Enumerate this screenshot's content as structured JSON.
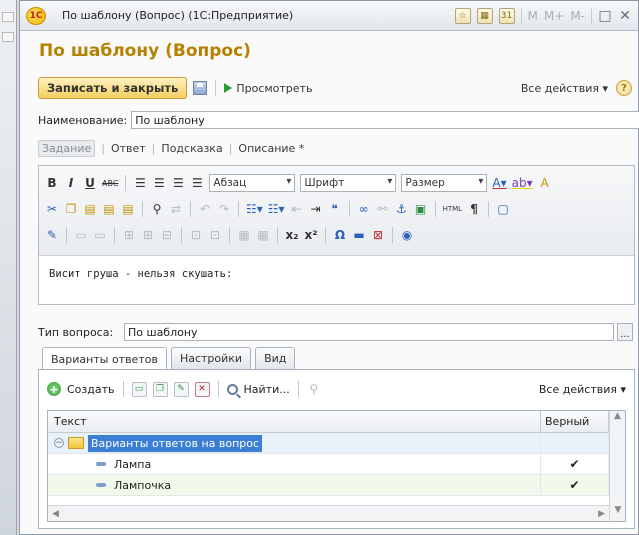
{
  "window": {
    "title": "По шаблону (Вопрос)  (1С:Предприятие)",
    "toolbar_text": [
      "M",
      "M+",
      "M-"
    ]
  },
  "form": {
    "title": "По шаблону (Вопрос)",
    "save_close_label": "Записать и закрыть",
    "view_label": "Просмотреть",
    "all_actions_label": "Все действия ▾",
    "help_label": "?"
  },
  "fields": {
    "name_label": "Наименование:",
    "name_value": "По шаблону",
    "qtype_label": "Тип вопроса:",
    "qtype_value": "По шаблону",
    "ellipsis": "..."
  },
  "tabs": [
    "Задание",
    "Ответ",
    "Подсказка",
    "Описание *"
  ],
  "editor": {
    "paragraph_combo": "Абзац",
    "font_combo": "Шрифт",
    "size_combo": "Размер",
    "content": "Висит груша - нельзя скушать:"
  },
  "subtabs": [
    "Варианты ответов",
    "Настройки",
    "Вид"
  ],
  "list": {
    "create_label": "Создать",
    "find_label": "Найти...",
    "all_actions_label": "Все действия ▾",
    "headers": [
      "Текст",
      "Верный"
    ],
    "group_label": "Варианты ответов на вопрос",
    "rows": [
      {
        "text": "Лампа",
        "correct": "✔"
      },
      {
        "text": "Лампочка",
        "correct": "✔"
      }
    ]
  },
  "colors": {
    "title_gold": "#b68100",
    "selection_blue": "#3a7fd5"
  }
}
